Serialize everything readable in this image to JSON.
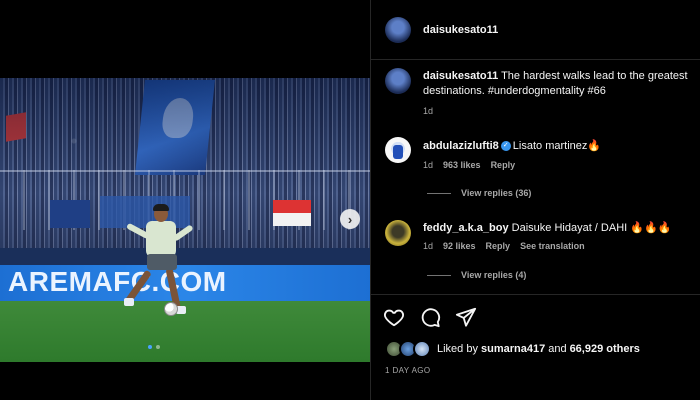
{
  "header": {
    "username": "daisukesato11"
  },
  "caption": {
    "username": "daisukesato11",
    "text": "The hardest walks lead to the greatest destinations. #underdogmentality #66",
    "age": "1d"
  },
  "comments": [
    {
      "username": "abdulazizlufti8",
      "verified": true,
      "text": "Lisato martinez🔥",
      "age": "1d",
      "likes": "963 likes",
      "reply_label": "Reply",
      "view_replies": "View replies (36)"
    },
    {
      "username": "feddy_a.k.a_boy",
      "verified": false,
      "text": "Daisuke Hidayat / DAHI 🔥🔥🔥",
      "age": "1d",
      "likes": "92 likes",
      "reply_label": "Reply",
      "translation": "See translation",
      "view_replies": "View replies (4)"
    }
  ],
  "media": {
    "board_text": "AREMAFC.COM",
    "next_icon": "chevron-right-icon",
    "carousel_total": 2,
    "carousel_active": 1
  },
  "actions": {
    "icons": [
      "heart-icon",
      "comment-icon",
      "share-icon"
    ]
  },
  "likes": {
    "prefix": "Liked by ",
    "user": "sumarna417",
    "middle": " and ",
    "others": "66,929 others"
  },
  "posted": "1 DAY AGO",
  "colors": {
    "verified": "#3897f0",
    "secondary_text": "#a8a8a8",
    "accent_dot": "#4aa3ff"
  }
}
